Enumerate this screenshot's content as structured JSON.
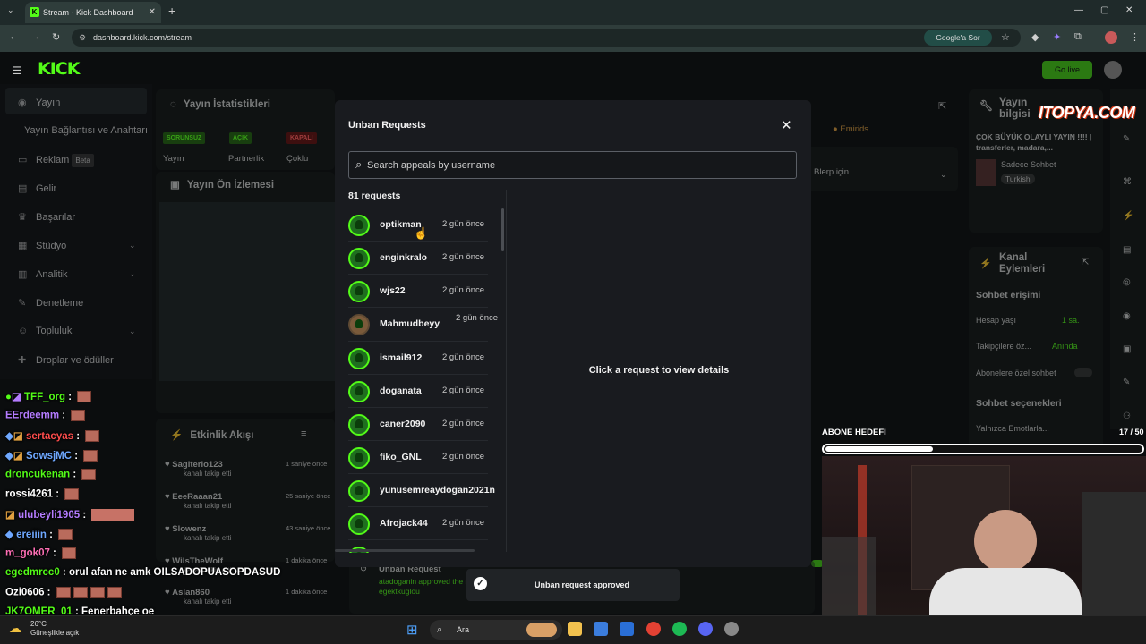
{
  "browser": {
    "tab_title": "Stream - Kick Dashboard",
    "favicon": "K",
    "url": "dashboard.kick.com/stream",
    "google_sor": "Google'a Sor"
  },
  "header": {
    "logo": "KICK",
    "go_live": "Go live"
  },
  "sidebar": {
    "items": [
      {
        "label": "Yayın"
      },
      {
        "label": "Yayın Bağlantısı ve Anahtarı"
      },
      {
        "label": "Reklam",
        "badge": "Beta"
      },
      {
        "label": "Gelir"
      },
      {
        "label": "Başarılar"
      },
      {
        "label": "Stüdyo"
      },
      {
        "label": "Analitik"
      },
      {
        "label": "Denetleme"
      },
      {
        "label": "Topluluk"
      },
      {
        "label": "Droplar ve ödüller"
      }
    ]
  },
  "background": {
    "stats_title": "Yayın İstatistikleri",
    "preview_title": "Yayın Ön İzlemesi",
    "activity_title": "Etkinlik Akışı",
    "badges": [
      "SORUNSUZ",
      "AÇIK",
      "KAPALI"
    ],
    "badge_labels": [
      "Yayın",
      "Partnerlik",
      "Çoklu"
    ],
    "emirids": "Emirids",
    "blerp": "Blerp için",
    "activity": [
      {
        "name": "Sagiterio123",
        "sub": "kanalı takip etti",
        "time": "1 saniye önce"
      },
      {
        "name": "EeeRaaan21",
        "sub": "kanalı takip etti",
        "time": "25 saniye önce"
      },
      {
        "name": "Slowenz",
        "sub": "kanalı takip etti",
        "time": "43 saniye önce"
      },
      {
        "name": "WilsTheWolf",
        "sub": "kanalı takip etti",
        "time": "1 dakika önce"
      },
      {
        "name": "Aslan860",
        "sub": "kanalı takip etti",
        "time": "1 dakika önce"
      }
    ],
    "unban_title": "Unban Request",
    "unban_sub": "atadoganin approved the request for",
    "unban_user": "egektkuglou"
  },
  "right_panel": {
    "title": "Yayın bilgisi",
    "stream_title": "ÇOK BÜYÜK OLAYLI YAYIN !!!! | transferler, madara,...",
    "category": "Sadece Sohbet",
    "language": "Turkish",
    "actions_title": "Kanal Eylemleri",
    "chat_access": "Sohbet erişimi",
    "account_age": "Hesap yaşı",
    "account_age_val": "1 sa.",
    "followers_only": "Takipçilere öz...",
    "followers_only_val": "Anında",
    "subs_only": "Abonelere özel sohbet",
    "chat_options": "Sohbet seçenekleri",
    "emotes_only": "Yalnızca Emotlarla..."
  },
  "watermark": "ITOPYA.COM",
  "modal": {
    "title": "Unban Requests",
    "search_placeholder": "Search appeals by username",
    "count": "81 requests",
    "requests": [
      {
        "name": "optikman",
        "time": "2 gün önce"
      },
      {
        "name": "enginkralo",
        "time": "2 gün önce"
      },
      {
        "name": "wjs22",
        "time": "2 gün önce"
      },
      {
        "name": "Mahmudbeyy",
        "time": "2 gün önce"
      },
      {
        "name": "ismail912",
        "time": "2 gün önce"
      },
      {
        "name": "doganata",
        "time": "2 gün önce"
      },
      {
        "name": "caner2090",
        "time": "2 gün önce"
      },
      {
        "name": "fiko_GNL",
        "time": "2 gün önce"
      },
      {
        "name": "yunusemreaydogan2021n",
        "time": ""
      },
      {
        "name": "Afrojack44",
        "time": "2 gün önce"
      }
    ],
    "detail_placeholder": "Click a request to view details"
  },
  "toast": "Unban request approved",
  "chat": [
    {
      "user": "TFF_org",
      "color": "#53fc18",
      "text": ""
    },
    {
      "user": "EErdeemm",
      "color": "#b47cff",
      "text": ""
    },
    {
      "user": "sertacyas",
      "color": "#ff4d4d",
      "text": ""
    },
    {
      "user": "SowsjMC",
      "color": "#6fa8ff",
      "text": ""
    },
    {
      "user": "droncukenan",
      "color": "#53fc18",
      "text": ""
    },
    {
      "user": "rossi4261",
      "color": "#ffffff",
      "text": ""
    },
    {
      "user": "ulubeyli1905",
      "color": "#b47cff",
      "text": ""
    },
    {
      "user": "ereiiin",
      "color": "#6fa8ff",
      "text": ""
    },
    {
      "user": "m_gok07",
      "color": "#ff6fb5",
      "text": ""
    },
    {
      "user": "egedmrcc0",
      "color": "#53fc18",
      "text": "orul afan ne amk OILSADOPUASOPDASUD"
    },
    {
      "user": "Ozi0606",
      "color": "#ffffff",
      "text": ""
    },
    {
      "user": "JK7OMER_01",
      "color": "#53fc18",
      "text": "Fenerbahçe oe"
    }
  ],
  "sub_goal": {
    "label": "ABONE HEDEFİ",
    "count": "17 / 50",
    "progress": 0.34
  },
  "taskbar": {
    "search": "Ara",
    "weather_temp": "26°C",
    "weather_text": "Güneşlikle açık"
  }
}
